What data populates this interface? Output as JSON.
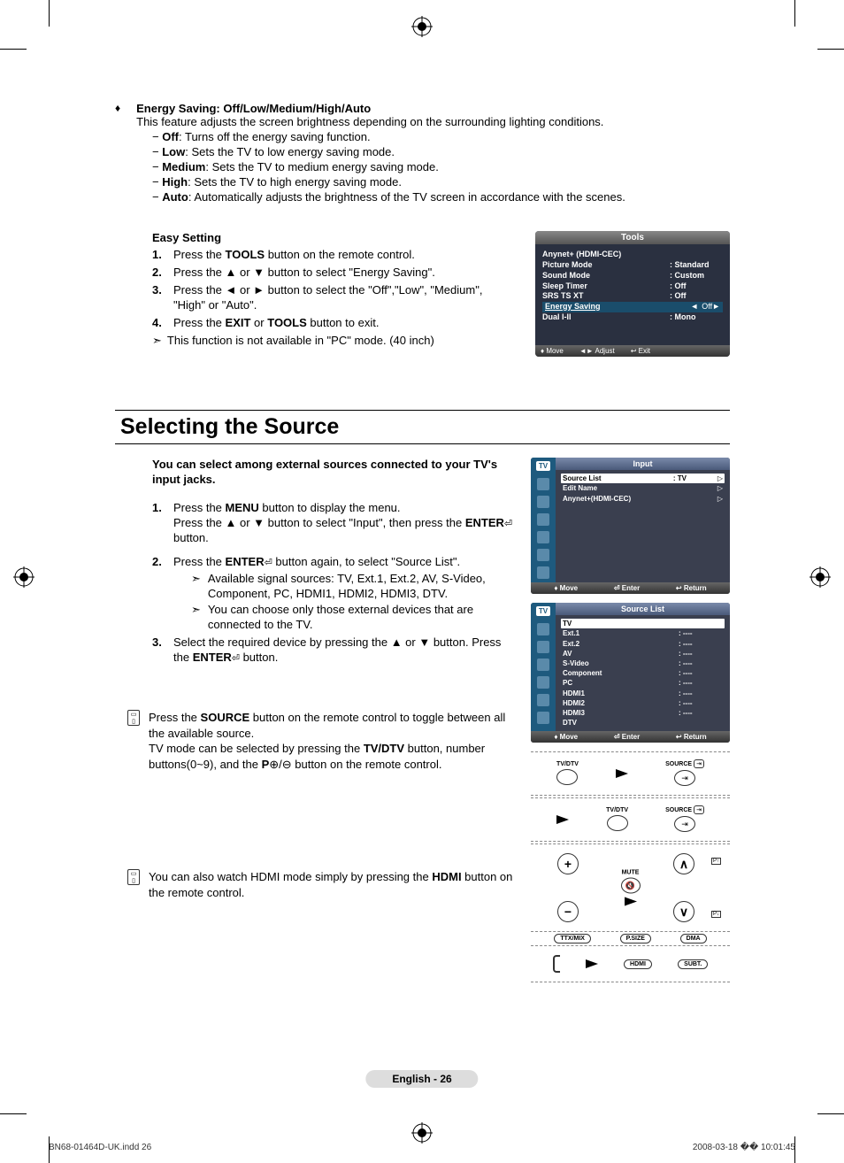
{
  "energysaving": {
    "title": "Energy Saving:  Off/Low/Medium/High/Auto",
    "desc": "This feature adjusts the screen brightness depending on the surrounding lighting conditions.",
    "off": {
      "label": "Off",
      "desc": ": Turns off the energy saving function."
    },
    "low": {
      "label": "Low",
      "desc": ": Sets the TV to low energy saving mode."
    },
    "medium": {
      "label": "Medium",
      "desc": ": Sets the TV to medium energy saving mode."
    },
    "high": {
      "label": "High",
      "desc": ": Sets the TV to high energy saving mode."
    },
    "auto": {
      "label": "Auto",
      "desc": ": Automatically adjusts the brightness of the TV screen in accordance with the scenes."
    }
  },
  "easy": {
    "heading": "Easy Setting",
    "s1a": "Press the ",
    "s1b": "TOOLS",
    "s1c": " button on the remote control.",
    "s2": "Press the ▲ or ▼ button to select \"Energy Saving\".",
    "s3": "Press the ◄ or ► button to select the \"Off\",\"Low\", \"Medium\",  \"High\" or \"Auto\".",
    "s4a": "Press the ",
    "s4b": "EXIT",
    "s4c": " or ",
    "s4d": "TOOLS",
    "s4e": " button to exit.",
    "note": "This function is not available in \"PC\" mode. (40 inch)"
  },
  "tools": {
    "title": "Tools",
    "r1": {
      "l": "Anynet+ (HDMI-CEC)",
      "v": ""
    },
    "r2": {
      "l": "Picture Mode",
      "v": ": Standard"
    },
    "r3": {
      "l": "Sound Mode",
      "v": ": Custom"
    },
    "r4": {
      "l": "Sleep Timer",
      "v": ": Off"
    },
    "r5": {
      "l": "SRS TS XT",
      "v": ": Off"
    },
    "r6": {
      "l": "Energy Saving",
      "v": "Off"
    },
    "r7": {
      "l": "Dual l-ll",
      "v": ": Mono"
    },
    "bottom": {
      "move": "Move",
      "adjust": "Adjust",
      "exit": "Exit"
    }
  },
  "section": {
    "title": "Selecting the Source",
    "intro": "You can select among external sources connected to your TV's input jacks.",
    "s1a": "Press the ",
    "s1b": "MENU",
    "s1c": " button to display the menu.",
    "s1d": "Press the ▲ or ▼ button to select \"Input\", then press the ",
    "s1e": "ENTER",
    "s1f": " button.",
    "s2a": "Press the ",
    "s2b": "ENTER",
    "s2c": " button again, to select \"Source List\".",
    "s2n1": "Available signal sources:  TV, Ext.1, Ext.2, AV, S-Video, Component, PC, HDMI1, HDMI2, HDMI3, DTV.",
    "s2n2": "You can choose only those external devices that are connected to the TV.",
    "s3a": "Select the required device by pressing the ▲ or ▼ button. Press the ",
    "s3b": "ENTER",
    "s3c": " button."
  },
  "osd1": {
    "sidebar": "TV",
    "title": "Input",
    "r1": {
      "l": "Source List",
      "v": ": TV"
    },
    "r2": {
      "l": "Edit Name",
      "v": ""
    },
    "r3": {
      "l": "Anynet+(HDMI-CEC)",
      "v": ""
    },
    "bottom": {
      "move": "Move",
      "enter": "Enter",
      "ret": "Return"
    }
  },
  "osd2": {
    "sidebar": "TV",
    "title": "Source List",
    "rows": [
      {
        "l": "TV",
        "v": "",
        "hl": true
      },
      {
        "l": "Ext.1",
        "v": ": ----"
      },
      {
        "l": "Ext.2",
        "v": ": ----"
      },
      {
        "l": "AV",
        "v": ": ----"
      },
      {
        "l": "S-Video",
        "v": ": ----"
      },
      {
        "l": "Component",
        "v": ": ----"
      },
      {
        "l": "PC",
        "v": ": ----"
      },
      {
        "l": "HDMI1",
        "v": ": ----"
      },
      {
        "l": "HDMI2",
        "v": ": ----"
      },
      {
        "l": "HDMI3",
        "v": ": ----"
      },
      {
        "l": "DTV",
        "v": ""
      }
    ],
    "bottom": {
      "move": "Move",
      "enter": "Enter",
      "ret": "Return"
    }
  },
  "note1": {
    "a": "Press the ",
    "b": "SOURCE",
    "c": " button on the remote control to toggle between all the available source.",
    "d": "TV mode can be selected by pressing the ",
    "e": "TV/DTV",
    "f": " button, number buttons(0~9), and the ",
    "g": "P",
    "h": " button on the remote control."
  },
  "note2": {
    "a": "You can also watch HDMI mode simply by pressing the ",
    "b": "HDMI",
    "c": " button on the remote control."
  },
  "remote": {
    "tvdtv": "TV/DTV",
    "source": "SOURCE",
    "hdmi": "HDMI",
    "subt": "SUBT.",
    "mute": "MUTE",
    "psize": "P.SIZE",
    "dma": "DMA",
    "ttxmix": "TTX/MIX"
  },
  "footer": {
    "page": "English - 26"
  },
  "docmeta": {
    "file": "BN68-01464D-UK.indd   26",
    "ts": "2008-03-18   �� 10:01:45"
  }
}
